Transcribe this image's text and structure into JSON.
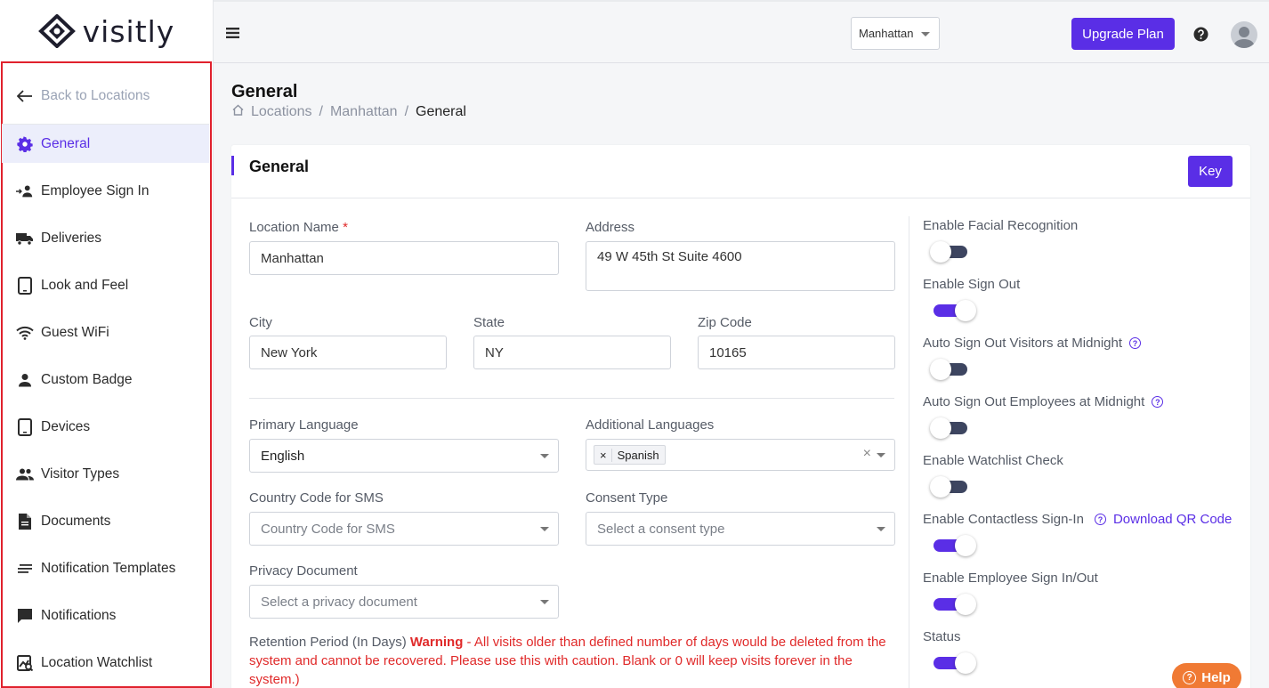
{
  "brand": {
    "name": "visitly",
    "accent": "#5a2ee6"
  },
  "topbar": {
    "location_value": "Manhattan",
    "upgrade_label": "Upgrade Plan"
  },
  "sidebar": {
    "back_label": "Back to Locations",
    "items": [
      {
        "label": "General",
        "icon": "gear-icon",
        "active": true
      },
      {
        "label": "Employee Sign In",
        "icon": "employee-signin-icon"
      },
      {
        "label": "Deliveries",
        "icon": "truck-icon"
      },
      {
        "label": "Look and Feel",
        "icon": "tablet-icon"
      },
      {
        "label": "Guest WiFi",
        "icon": "wifi-icon"
      },
      {
        "label": "Custom Badge",
        "icon": "person-icon"
      },
      {
        "label": "Devices",
        "icon": "tablet-icon"
      },
      {
        "label": "Visitor Types",
        "icon": "people-icon"
      },
      {
        "label": "Documents",
        "icon": "document-icon"
      },
      {
        "label": "Notification Templates",
        "icon": "lines-icon"
      },
      {
        "label": "Notifications",
        "icon": "chat-icon"
      },
      {
        "label": "Location Watchlist",
        "icon": "watchlist-icon"
      }
    ]
  },
  "page": {
    "title": "General",
    "breadcrumb": [
      "Locations",
      "Manhattan",
      "General"
    ]
  },
  "card": {
    "title": "General",
    "key_label": "Key"
  },
  "form": {
    "location_name_label": "Location Name",
    "location_name_required": "*",
    "location_name_value": "Manhattan",
    "address_label": "Address",
    "address_value": "49 W 45th St Suite 4600",
    "city_label": "City",
    "city_value": "New York",
    "state_label": "State",
    "state_value": "NY",
    "zip_label": "Zip Code",
    "zip_value": "10165",
    "primary_language_label": "Primary Language",
    "primary_language_value": "English",
    "additional_languages_label": "Additional Languages",
    "additional_languages_chip_x": "×",
    "additional_languages_chip": "Spanish",
    "clear_symbol": "×",
    "country_code_label": "Country Code for SMS",
    "country_code_placeholder": "Country Code for SMS",
    "consent_type_label": "Consent Type",
    "consent_type_placeholder": "Select a consent type",
    "privacy_document_label": "Privacy Document",
    "privacy_document_placeholder": "Select a privacy document",
    "retention_label": "Retention Period (In Days)",
    "retention_warning_word": "Warning",
    "retention_warning_text": " - All visits older than defined number of days would be deleted from the system and cannot be recovered. Please use this with caution. Blank or 0 will keep visits forever in the system.)"
  },
  "toggles": [
    {
      "label": "Enable Facial Recognition",
      "on": false,
      "help": false
    },
    {
      "label": "Enable Sign Out",
      "on": true,
      "help": false
    },
    {
      "label": "Auto Sign Out Visitors at Midnight",
      "on": false,
      "help": true
    },
    {
      "label": "Auto Sign Out Employees at Midnight",
      "on": false,
      "help": true
    },
    {
      "label": "Enable Watchlist Check",
      "on": false,
      "help": false
    },
    {
      "label": "Enable Contactless Sign-In",
      "on": true,
      "help": true,
      "link": "Download QR Code"
    },
    {
      "label": "Enable Employee Sign In/Out",
      "on": true,
      "help": false
    },
    {
      "label": "Status",
      "on": true,
      "help": false
    }
  ],
  "help_label": "Help"
}
